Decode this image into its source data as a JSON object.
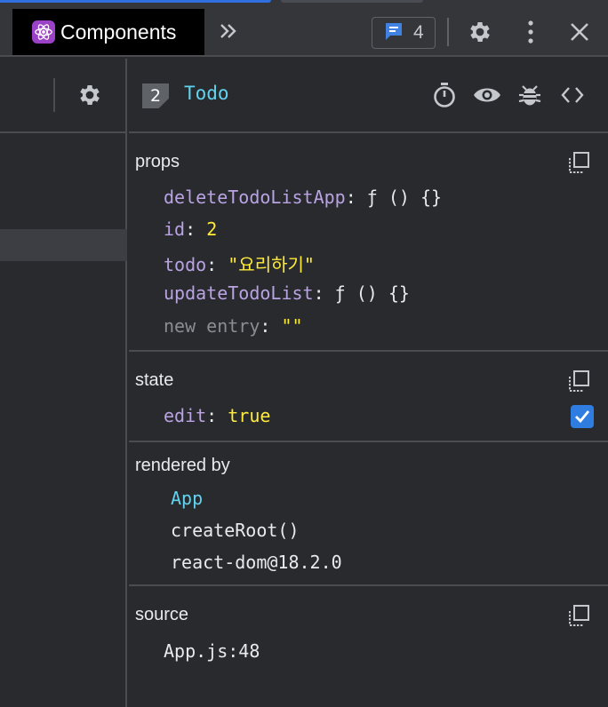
{
  "tabbar": {
    "active_tab": "Components",
    "issues_count": "4",
    "icons": [
      "react-logo-icon",
      "double-chevron-icon",
      "message-icon",
      "gear-icon",
      "kebab-menu-icon",
      "close-icon"
    ]
  },
  "left_pane": {
    "icons": [
      "gear-icon"
    ]
  },
  "component": {
    "key": "2",
    "name": "Todo",
    "icons": [
      "stopwatch-icon",
      "eye-icon",
      "bug-icon",
      "code-icon"
    ]
  },
  "props": {
    "title": "props",
    "items": [
      {
        "key": "deleteTodoListApp",
        "value": "ƒ () {}",
        "type": "function"
      },
      {
        "key": "id",
        "value": "2",
        "type": "number"
      },
      {
        "key": "todo",
        "value": "\"요리하기\"",
        "type": "string"
      },
      {
        "key": "updateTodoList",
        "value": "ƒ () {}",
        "type": "function"
      }
    ],
    "new_entry_key": "new entry",
    "new_entry_value": "\"\""
  },
  "state": {
    "title": "state",
    "items": [
      {
        "key": "edit",
        "value": "true",
        "type": "boolean",
        "checked": true
      }
    ]
  },
  "rendered_by": {
    "title": "rendered by",
    "items": [
      "App",
      "createRoot()",
      "react-dom@18.2.0"
    ]
  },
  "source": {
    "title": "source",
    "value": "App.js:48"
  },
  "colors": {
    "background": "#282a2e",
    "toolbar": "#35363a",
    "accent": "#2f7de1",
    "component_name": "#61d3ee",
    "prop_key": "#b9a3e3",
    "value": "#ffeb3b",
    "react_badge": "#9b41c6"
  }
}
